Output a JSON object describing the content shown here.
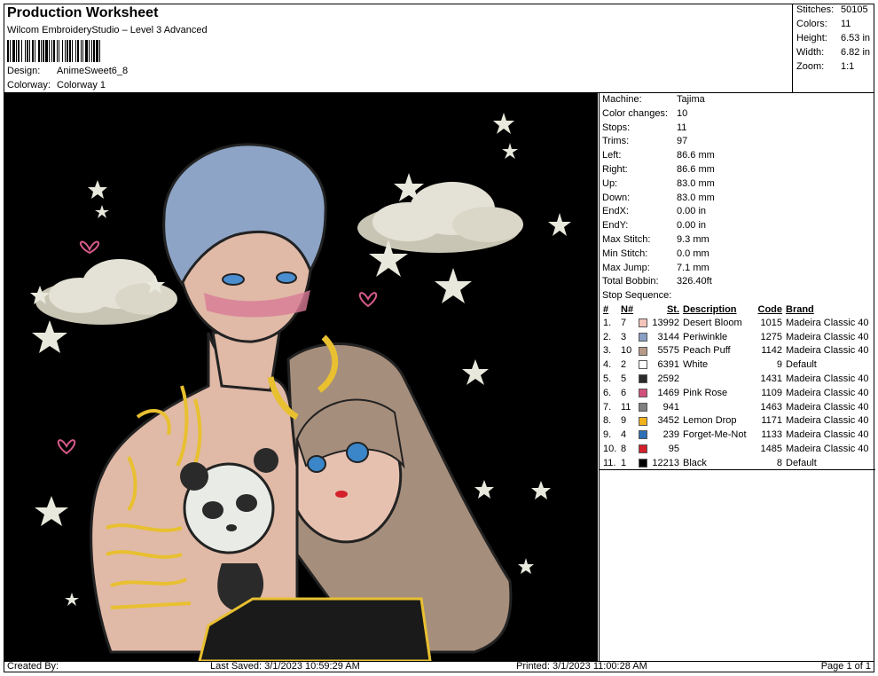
{
  "header": {
    "title": "Production Worksheet",
    "subtitle": "Wilcom EmbroideryStudio – Level 3 Advanced",
    "design_label": "Design:",
    "design_value": "AnimeSweet6_8",
    "colorway_label": "Colorway:",
    "colorway_value": "Colorway 1"
  },
  "summary": {
    "stitches_label": "Stitches:",
    "stitches_value": "50105",
    "colors_label": "Colors:",
    "colors_value": "11",
    "height_label": "Height:",
    "height_value": "6.53 in",
    "width_label": "Width:",
    "width_value": "6.82 in",
    "zoom_label": "Zoom:",
    "zoom_value": "1:1"
  },
  "details": [
    {
      "label": "Machine:",
      "value": "Tajima"
    },
    {
      "label": "Color changes:",
      "value": "10"
    },
    {
      "label": "Stops:",
      "value": "11"
    },
    {
      "label": "Trims:",
      "value": "97"
    },
    {
      "label": "Left:",
      "value": "86.6 mm"
    },
    {
      "label": "Right:",
      "value": "86.6 mm"
    },
    {
      "label": "Up:",
      "value": "83.0 mm"
    },
    {
      "label": "Down:",
      "value": "83.0 mm"
    },
    {
      "label": "EndX:",
      "value": "0.00 in"
    },
    {
      "label": "EndY:",
      "value": "0.00 in"
    },
    {
      "label": "Max Stitch:",
      "value": "9.3 mm"
    },
    {
      "label": "Min Stitch:",
      "value": "0.0 mm"
    },
    {
      "label": "Max Jump:",
      "value": "7.1 mm"
    },
    {
      "label": "Total Bobbin:",
      "value": "326.40ft"
    }
  ],
  "stop_sequence": {
    "title": "Stop Sequence:",
    "columns": [
      "#",
      "N#",
      "St.",
      "Description",
      "Code",
      "Brand"
    ],
    "rows": [
      {
        "idx": "1.",
        "n": "7",
        "color": "#f4c4bb",
        "st": "13992",
        "desc": "Desert Bloom",
        "code": "1015",
        "brand": "Madeira Classic 40"
      },
      {
        "idx": "2.",
        "n": "3",
        "color": "#8a9fc4",
        "st": "3144",
        "desc": "Periwinkle",
        "code": "1275",
        "brand": "Madeira Classic 40"
      },
      {
        "idx": "3.",
        "n": "10",
        "color": "#b89a88",
        "st": "5575",
        "desc": "Peach Puff",
        "code": "1142",
        "brand": "Madeira Classic 40"
      },
      {
        "idx": "4.",
        "n": "2",
        "color": "#ffffff",
        "st": "6391",
        "desc": "White",
        "code": "9",
        "brand": "Default"
      },
      {
        "idx": "5.",
        "n": "5",
        "color": "#2a2a2a",
        "st": "2592",
        "desc": "",
        "code": "1431",
        "brand": "Madeira Classic 40"
      },
      {
        "idx": "6.",
        "n": "6",
        "color": "#d2507a",
        "st": "1469",
        "desc": "Pink Rose",
        "code": "1109",
        "brand": "Madeira Classic 40"
      },
      {
        "idx": "7.",
        "n": "11",
        "color": "#808080",
        "st": "941",
        "desc": "",
        "code": "1463",
        "brand": "Madeira Classic 40"
      },
      {
        "idx": "8.",
        "n": "9",
        "color": "#f2b21c",
        "st": "3452",
        "desc": "Lemon Drop",
        "code": "1171",
        "brand": "Madeira Classic 40"
      },
      {
        "idx": "9.",
        "n": "4",
        "color": "#2f6fb8",
        "st": "239",
        "desc": "Forget-Me-Not",
        "code": "1133",
        "brand": "Madeira Classic 40"
      },
      {
        "idx": "10.",
        "n": "8",
        "color": "#d4202a",
        "st": "95",
        "desc": "",
        "code": "1485",
        "brand": "Madeira Classic 40"
      },
      {
        "idx": "11.",
        "n": "1",
        "color": "#000000",
        "st": "12213",
        "desc": "Black",
        "code": "8",
        "brand": "Default"
      }
    ]
  },
  "footer": {
    "created": "Created By:",
    "last_saved": "Last Saved: 3/1/2023 10:59:29 AM",
    "printed": "Printed: 3/1/2023 11:00:28 AM",
    "page": "Page 1 of 1"
  }
}
